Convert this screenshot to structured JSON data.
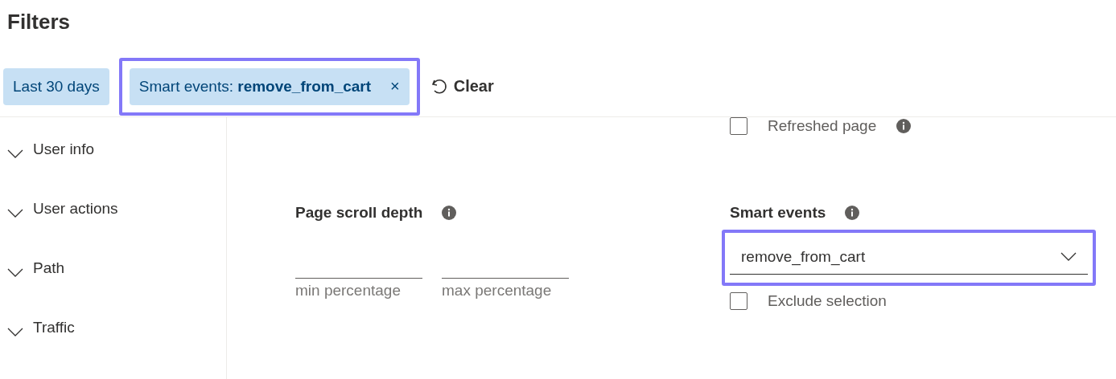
{
  "title": "Filters",
  "chips": [
    {
      "label": "Last 30 days",
      "highlighted": false,
      "removable": false
    },
    {
      "label": "Smart events: **remove_from_cart**",
      "highlighted": true,
      "removable": true,
      "remove_glyph": "×"
    }
  ],
  "clear_button": {
    "label": "Clear"
  },
  "sidebar": {
    "items": [
      {
        "label": "User info",
        "expanded": false
      },
      {
        "label": "User actions",
        "expanded": false
      },
      {
        "label": "Path",
        "expanded": false
      },
      {
        "label": "Traffic",
        "expanded": false
      }
    ]
  },
  "refreshed_page": {
    "label": "Refreshed page",
    "checked": false
  },
  "page_scroll_depth": {
    "label": "Page scroll depth",
    "fields": [
      {
        "caption": "min percentage"
      },
      {
        "caption": "max percentage"
      }
    ]
  },
  "smart_events": {
    "label": "Smart events",
    "dropdown": {
      "value": "remove_from_cart",
      "highlighted": true
    },
    "exclude": {
      "label": "Exclude selection",
      "checked": false
    }
  }
}
